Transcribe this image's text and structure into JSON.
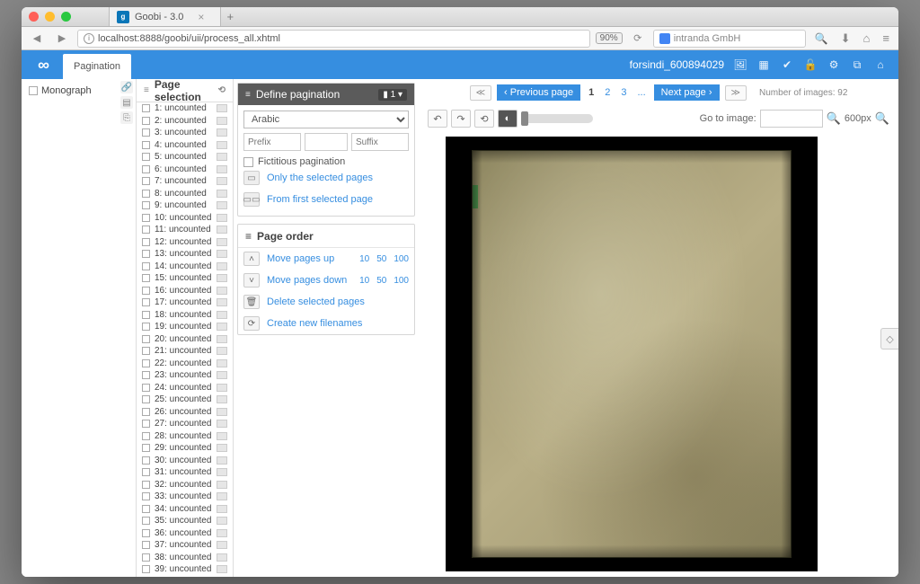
{
  "browser": {
    "tab_title": "Goobi - 3.0",
    "url": "localhost:8888/goobi/uii/process_all.xhtml",
    "zoom": "90%",
    "search_placeholder": "intranda GmbH"
  },
  "appbar": {
    "active_tab": "Pagination",
    "user": "forsindi_600894029"
  },
  "structure": {
    "root": "Monograph"
  },
  "page_selection": {
    "title": "Page selection",
    "items": [
      "1: uncounted",
      "2: uncounted",
      "3: uncounted",
      "4: uncounted",
      "5: uncounted",
      "6: uncounted",
      "7: uncounted",
      "8: uncounted",
      "9: uncounted",
      "10: uncounted",
      "11: uncounted",
      "12: uncounted",
      "13: uncounted",
      "14: uncounted",
      "15: uncounted",
      "16: uncounted",
      "17: uncounted",
      "18: uncounted",
      "19: uncounted",
      "20: uncounted",
      "21: uncounted",
      "22: uncounted",
      "23: uncounted",
      "24: uncounted",
      "25: uncounted",
      "26: uncounted",
      "27: uncounted",
      "28: uncounted",
      "29: uncounted",
      "30: uncounted",
      "31: uncounted",
      "32: uncounted",
      "33: uncounted",
      "34: uncounted",
      "35: uncounted",
      "36: uncounted",
      "37: uncounted",
      "38: uncounted",
      "39: uncounted"
    ]
  },
  "define_pagination": {
    "title": "Define pagination",
    "badge": "1",
    "type_select": "Arabic",
    "prefix_placeholder": "Prefix",
    "suffix_placeholder": "Suffix",
    "fictitious_label": "Fictitious pagination",
    "only_selected": "Only the selected pages",
    "from_first": "From first selected page"
  },
  "page_order": {
    "title": "Page order",
    "move_up": "Move pages up",
    "move_down": "Move pages down",
    "delete_selected": "Delete selected pages",
    "create_new": "Create new filenames",
    "nums": [
      "10",
      "50",
      "100"
    ]
  },
  "pager": {
    "prev": "Previous page",
    "next": "Next page",
    "pages": [
      "1",
      "2",
      "3",
      "..."
    ],
    "count_label": "Number of images: 92"
  },
  "image_tools": {
    "goto_label": "Go to image:",
    "size_label": "600px"
  }
}
